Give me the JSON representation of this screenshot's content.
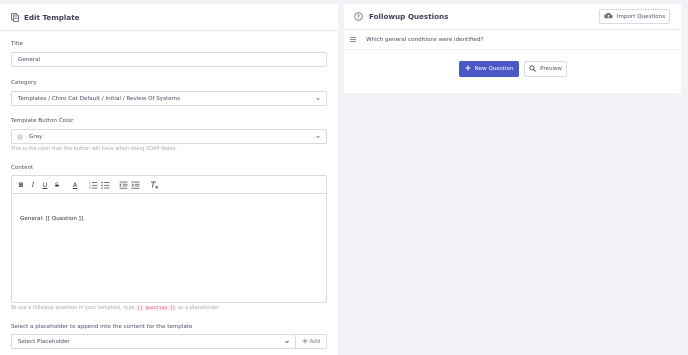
{
  "left_panel": {
    "title": "Edit Template",
    "title_field": {
      "label": "Title",
      "value": "General"
    },
    "category_field": {
      "label": "Category",
      "value": "Templates / Chiro Cat Default / Initial / Review Of Systems"
    },
    "color_field": {
      "label": "Template Button Color",
      "value": "Gray",
      "swatch_color": "#d6d7dc",
      "help": "This is the color that the button will have when doing SOAP Notes."
    },
    "content": {
      "label": "Content",
      "toolbar": [
        "B",
        "I",
        "U",
        "S",
        "A",
        "ordered-list",
        "bullet-list",
        "outdent",
        "indent",
        "clear-format"
      ],
      "text": "General: [[ Question ]].",
      "help_before": "To use a followup question in your template, type",
      "help_tag": "[[ question ]]",
      "help_after": "as a placeholder."
    },
    "placeholder_select": {
      "label": "Select a placeholder to append into the content for the template",
      "value": "Select Placeholder",
      "add_label": "Add"
    }
  },
  "right_panel": {
    "title": "Followup Questions",
    "import_label": "Import Questions",
    "questions": [
      "Which general conditions were identified?"
    ],
    "new_question_label": "New Question",
    "preview_label": "Preview",
    "accent": "#4a58c5"
  }
}
